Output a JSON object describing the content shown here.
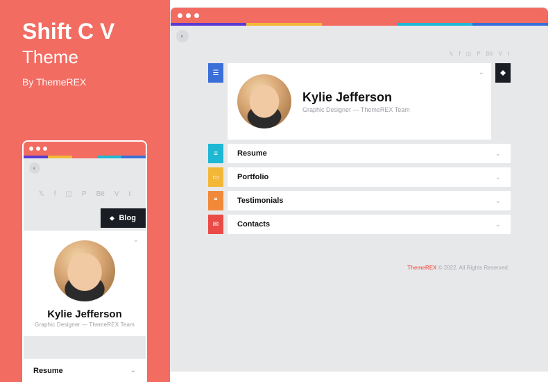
{
  "left": {
    "title": "Shift C V",
    "subtitle": "Theme",
    "author": "By ThemeREX"
  },
  "stripe_colors": [
    "#5b3bd1",
    "#f3b738",
    "#f26c62",
    "#1fb8d4",
    "#3a6fd8"
  ],
  "social_icons": [
    "twitter",
    "facebook",
    "instagram",
    "pinterest",
    "behance",
    "vimeo",
    "tumblr"
  ],
  "mobile": {
    "blog_label": "Blog",
    "name": "Kylie Jefferson",
    "role": "Graphic Designer — ThemeREX Team",
    "resume_label": "Resume"
  },
  "desktop": {
    "name": "Kylie Jefferson",
    "role": "Graphic Designer — ThemeREX Team",
    "items": [
      {
        "color": "#1fb8d4",
        "icon": "menu",
        "label": "Resume"
      },
      {
        "color": "#f3b738",
        "icon": "briefcase",
        "label": "Portfolio"
      },
      {
        "color": "#f08a3a",
        "icon": "quote",
        "label": "Testimonials"
      },
      {
        "color": "#ea4b47",
        "icon": "mail",
        "label": "Contacts"
      }
    ],
    "footer_brand": "ThemeREX",
    "footer_text": " © 2022. All Rights Reserved."
  }
}
